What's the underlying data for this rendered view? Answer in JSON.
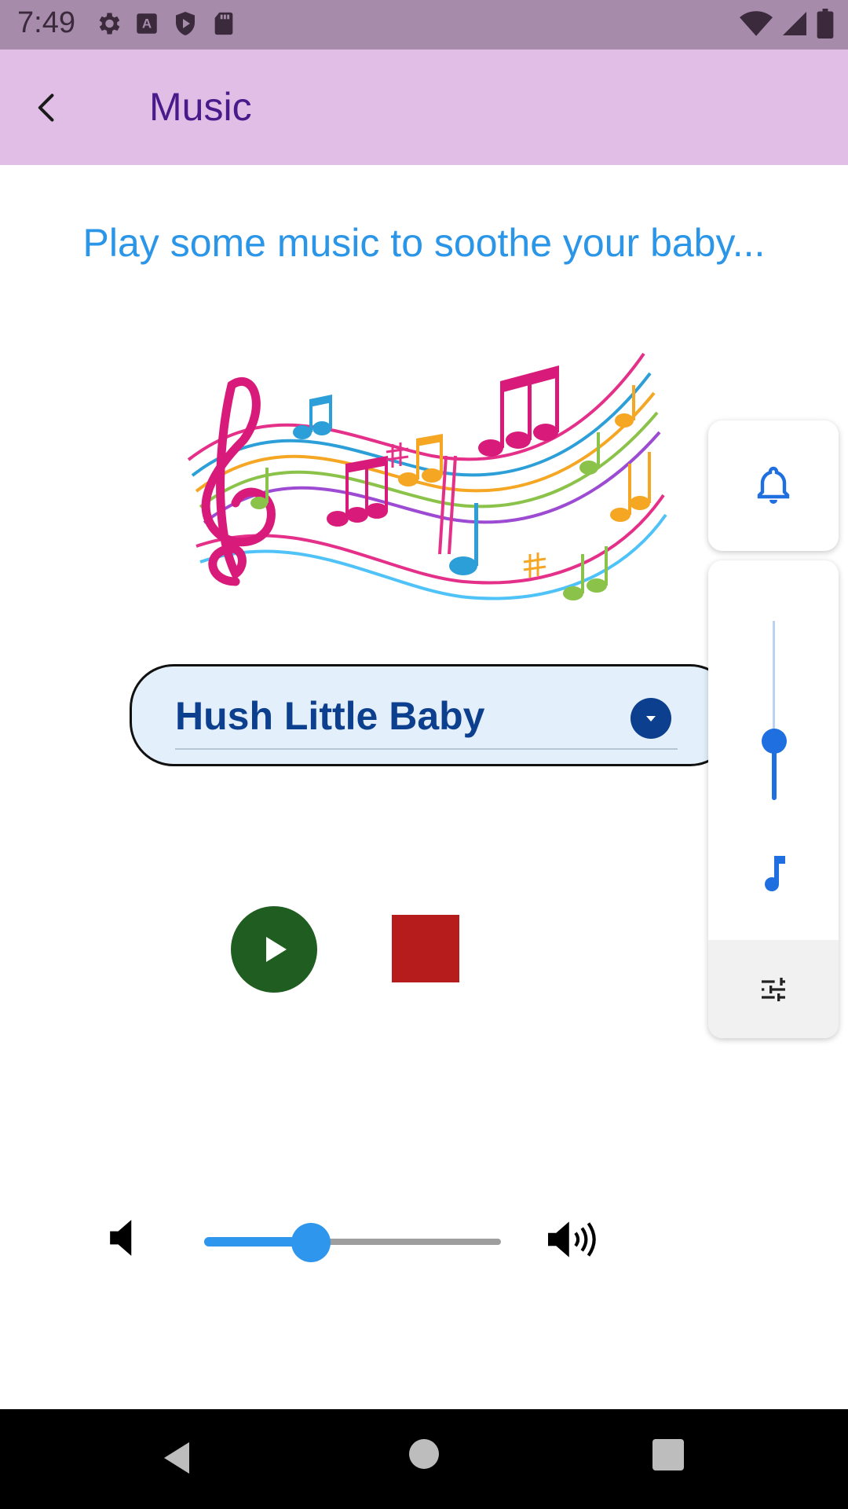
{
  "status_bar": {
    "time": "7:49",
    "left_icons": [
      "settings-icon",
      "a-keyboard-icon",
      "shield-play-icon",
      "sd-card-icon"
    ],
    "right_icons": [
      "wifi-icon",
      "signal-icon",
      "battery-icon"
    ]
  },
  "app_bar": {
    "title": "Music",
    "back_icon": "back-arrow-icon"
  },
  "subtitle": "Play some music to soothe your baby...",
  "hero_image": {
    "icon": "music-notes-illustration"
  },
  "song_dropdown": {
    "selected": "Hush Little Baby"
  },
  "controls": {
    "play_icon": "play-icon",
    "stop_icon": "stop-icon"
  },
  "volume": {
    "value": 0.36,
    "low_icon": "volume-low-icon",
    "high_icon": "volume-high-icon"
  },
  "side_panel": {
    "bell_icon": "bell-icon",
    "slider_value": 0.33,
    "note_icon": "music-note-icon",
    "tune_icon": "tune-icon"
  },
  "colors": {
    "status_bar": "#a68bab",
    "app_bar": "#e0bee6",
    "title": "#4a1a8a",
    "subtitle": "#2b96e8",
    "play": "#1f5e20",
    "stop": "#b71c1c",
    "accent": "#2e96ec"
  }
}
